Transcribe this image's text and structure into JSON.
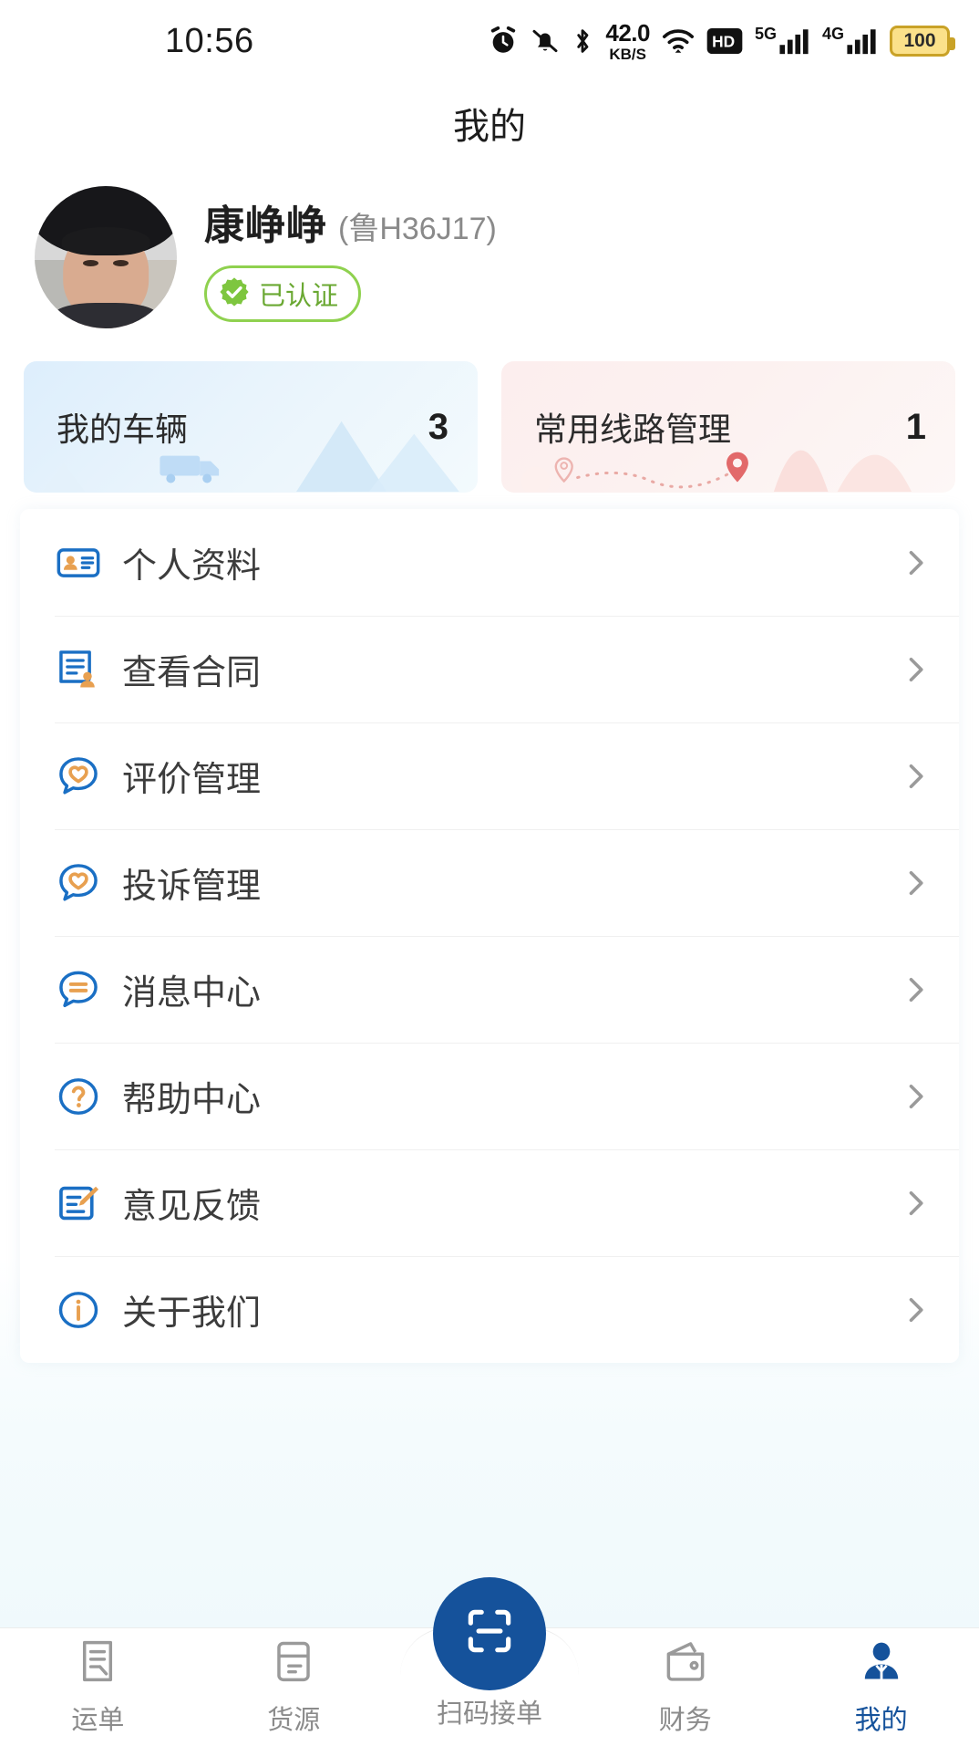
{
  "statusbar": {
    "time": "10:56",
    "netspeed_value": "42.0",
    "netspeed_unit": "KB/S",
    "hd_label": "HD",
    "sim1_label": "5G",
    "sim2_label": "4G",
    "battery_level": "100",
    "icons": [
      "alarm-icon",
      "bell-muted-icon",
      "bluetooth-icon",
      "network-speed",
      "wifi-icon",
      "hd-icon",
      "signal-5g-icon",
      "signal-4g-icon",
      "battery-icon"
    ]
  },
  "header": {
    "title": "我的"
  },
  "profile": {
    "name": "康峥峥",
    "plate": "(鲁H36J17)",
    "verified_label": "已认证",
    "verified_color": "#8fd14f",
    "avatar_name": "user-avatar-photo"
  },
  "cards": [
    {
      "label": "我的车辆",
      "count": "3",
      "theme": "blue",
      "accent": "#bcdcf5",
      "name": "my-vehicles-card"
    },
    {
      "label": "常用线路管理",
      "count": "1",
      "theme": "pink",
      "accent": "#f6c9c6",
      "name": "common-routes-card"
    }
  ],
  "menu": [
    {
      "label": "个人资料",
      "icon": "id-card-icon",
      "name": "menu-item-personal-info"
    },
    {
      "label": "查看合同",
      "icon": "contract-stamp-icon",
      "name": "menu-item-view-contract"
    },
    {
      "label": "评价管理",
      "icon": "review-heart-bubble-icon",
      "name": "menu-item-review-management"
    },
    {
      "label": "投诉管理",
      "icon": "complaint-heart-bubble-icon",
      "name": "menu-item-complaint-management"
    },
    {
      "label": "消息中心",
      "icon": "message-bubble-icon",
      "name": "menu-item-message-center"
    },
    {
      "label": "帮助中心",
      "icon": "help-question-icon",
      "name": "menu-item-help-center"
    },
    {
      "label": "意见反馈",
      "icon": "feedback-pencil-icon",
      "name": "menu-item-feedback"
    },
    {
      "label": "关于我们",
      "icon": "info-circle-icon",
      "name": "menu-item-about-us"
    }
  ],
  "tabbar": {
    "active_color": "#15529b",
    "inactive_color": "#8b8b8b",
    "items": [
      {
        "label": "运单",
        "icon": "waybill-icon",
        "active": false
      },
      {
        "label": "货源",
        "icon": "cargo-source-icon",
        "active": false
      },
      {
        "label": "扫码接单",
        "icon": "scan-qr-icon",
        "active": false
      },
      {
        "label": "财务",
        "icon": "wallet-icon",
        "active": false
      },
      {
        "label": "我的",
        "icon": "user-profile-icon",
        "active": true
      }
    ]
  }
}
